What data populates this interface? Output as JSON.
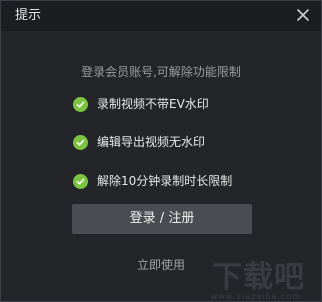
{
  "dialog": {
    "title": "提示",
    "close_icon": "close-icon",
    "subtitle": "登录会员账号,可解除功能限制",
    "features": [
      {
        "icon": "check-circle-icon",
        "label": "录制视频不带EV水印"
      },
      {
        "icon": "check-circle-icon",
        "label": "编辑导出视频无水印"
      },
      {
        "icon": "check-circle-icon",
        "label": "解除10分钟录制时长限制"
      }
    ],
    "login_button": "登录 / 注册",
    "use_now_link": "立即使用"
  },
  "watermark": {
    "text": "下载吧",
    "url": "www.xiazaiba.com"
  },
  "colors": {
    "check_green": "#7dc342",
    "background": "#232529",
    "titlebar": "#1b1d20",
    "button": "#494c51"
  }
}
